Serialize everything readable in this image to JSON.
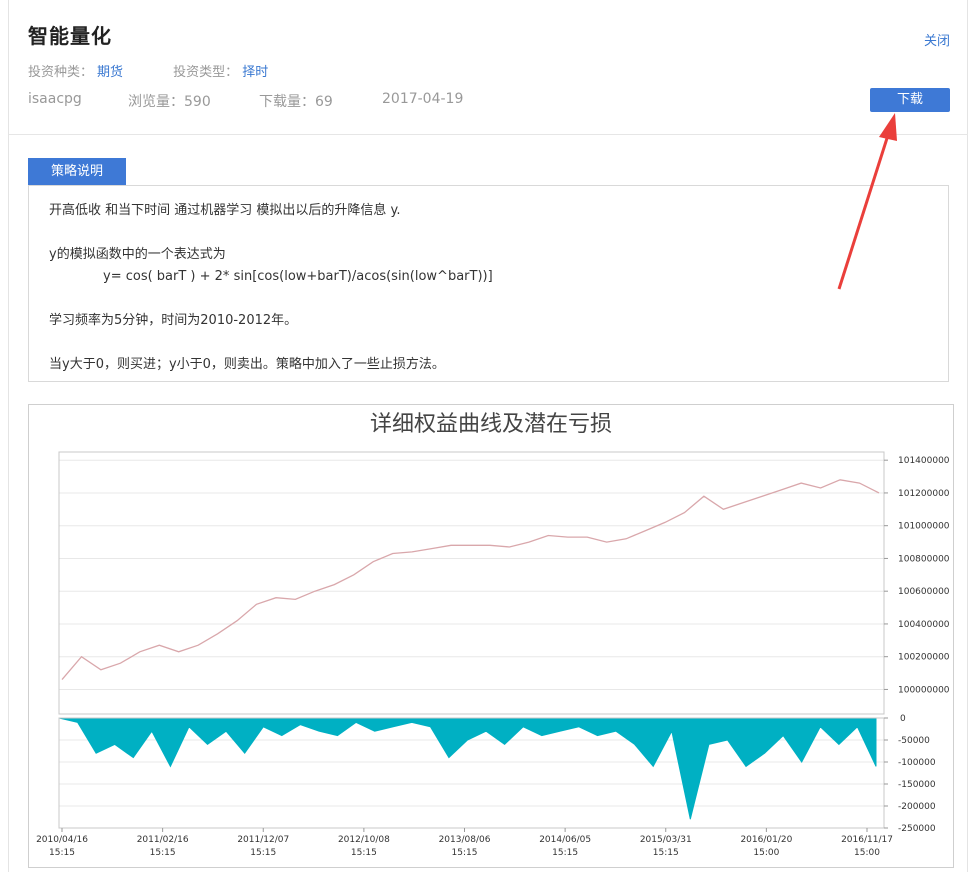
{
  "header": {
    "title": "智能量化",
    "close_label": "关闭",
    "invest_kind_label": "投资种类：",
    "invest_kind_value": "期货",
    "invest_type_label": "投资类型：",
    "invest_type_value": "择时",
    "author": "isaacpg",
    "views": "浏览量：590",
    "downloads": "下载量：69",
    "date": "2017-04-19",
    "download_label": "下载"
  },
  "strategy": {
    "tab_label": "策略说明",
    "line1": "开高低收 和当下时间 通过机器学习 模拟出以后的升降信息 y.",
    "line2": "y的模拟函数中的一个表达式为",
    "line3": "y= cos( barT )  + 2* sin[cos(low+barT)/acos(sin(low^barT))]",
    "line4": "学习频率为5分钟，时间为2010-2012年。",
    "line5": "当y大于0，则买进；y小于0，则卖出。策略中加入了一些止损方法。"
  },
  "chart_data": {
    "type": "line",
    "title": "详细权益曲线及潜在亏损",
    "x_tick_labels": [
      [
        "2010/04/16",
        "15:15"
      ],
      [
        "2011/02/16",
        "15:15"
      ],
      [
        "2011/12/07",
        "15:15"
      ],
      [
        "2012/10/08",
        "15:15"
      ],
      [
        "2013/08/06",
        "15:15"
      ],
      [
        "2014/06/05",
        "15:15"
      ],
      [
        "2015/03/31",
        "15:15"
      ],
      [
        "2016/01/20",
        "15:00"
      ],
      [
        "2016/11/17",
        "15:00"
      ]
    ],
    "equity": {
      "ylim": [
        99850000,
        101450000
      ],
      "y_ticks": [
        "101400000",
        "101200000",
        "101000000",
        "100800000",
        "100600000",
        "100400000",
        "100200000",
        "100000000"
      ],
      "y_tick_values": [
        101400000,
        101200000,
        101000000,
        100800000,
        100600000,
        100400000,
        100200000,
        100000000
      ],
      "color": "#d9a7ab",
      "values": [
        100060000,
        100200000,
        100120000,
        100160000,
        100230000,
        100270000,
        100230000,
        100270000,
        100340000,
        100420000,
        100520000,
        100560000,
        100550000,
        100600000,
        100640000,
        100700000,
        100780000,
        100830000,
        100840000,
        100860000,
        100880000,
        100880000,
        100880000,
        100870000,
        100900000,
        100940000,
        100930000,
        100930000,
        100900000,
        100920000,
        100970000,
        101020000,
        101080000,
        101180000,
        101100000,
        101140000,
        101180000,
        101220000,
        101260000,
        101230000,
        101280000,
        101260000,
        101200000
      ]
    },
    "drawdown": {
      "ylim": [
        -250000,
        0
      ],
      "y_ticks": [
        "0",
        "-50000",
        "-100000",
        "-150000",
        "-200000",
        "-250000"
      ],
      "y_tick_values": [
        0,
        -50000,
        -100000,
        -150000,
        -200000,
        -250000
      ],
      "color": "#00b0c3",
      "values": [
        0,
        -10000,
        -80000,
        -60000,
        -90000,
        -30000,
        -110000,
        -20000,
        -60000,
        -30000,
        -80000,
        -20000,
        -40000,
        -15000,
        -30000,
        -40000,
        -10000,
        -30000,
        -20000,
        -10000,
        -20000,
        -90000,
        -50000,
        -30000,
        -60000,
        -20000,
        -40000,
        -30000,
        -20000,
        -40000,
        -30000,
        -60000,
        -110000,
        -30000,
        -230000,
        -60000,
        -50000,
        -110000,
        -80000,
        -40000,
        -100000,
        -20000,
        -60000,
        -20000,
        -110000
      ]
    }
  }
}
